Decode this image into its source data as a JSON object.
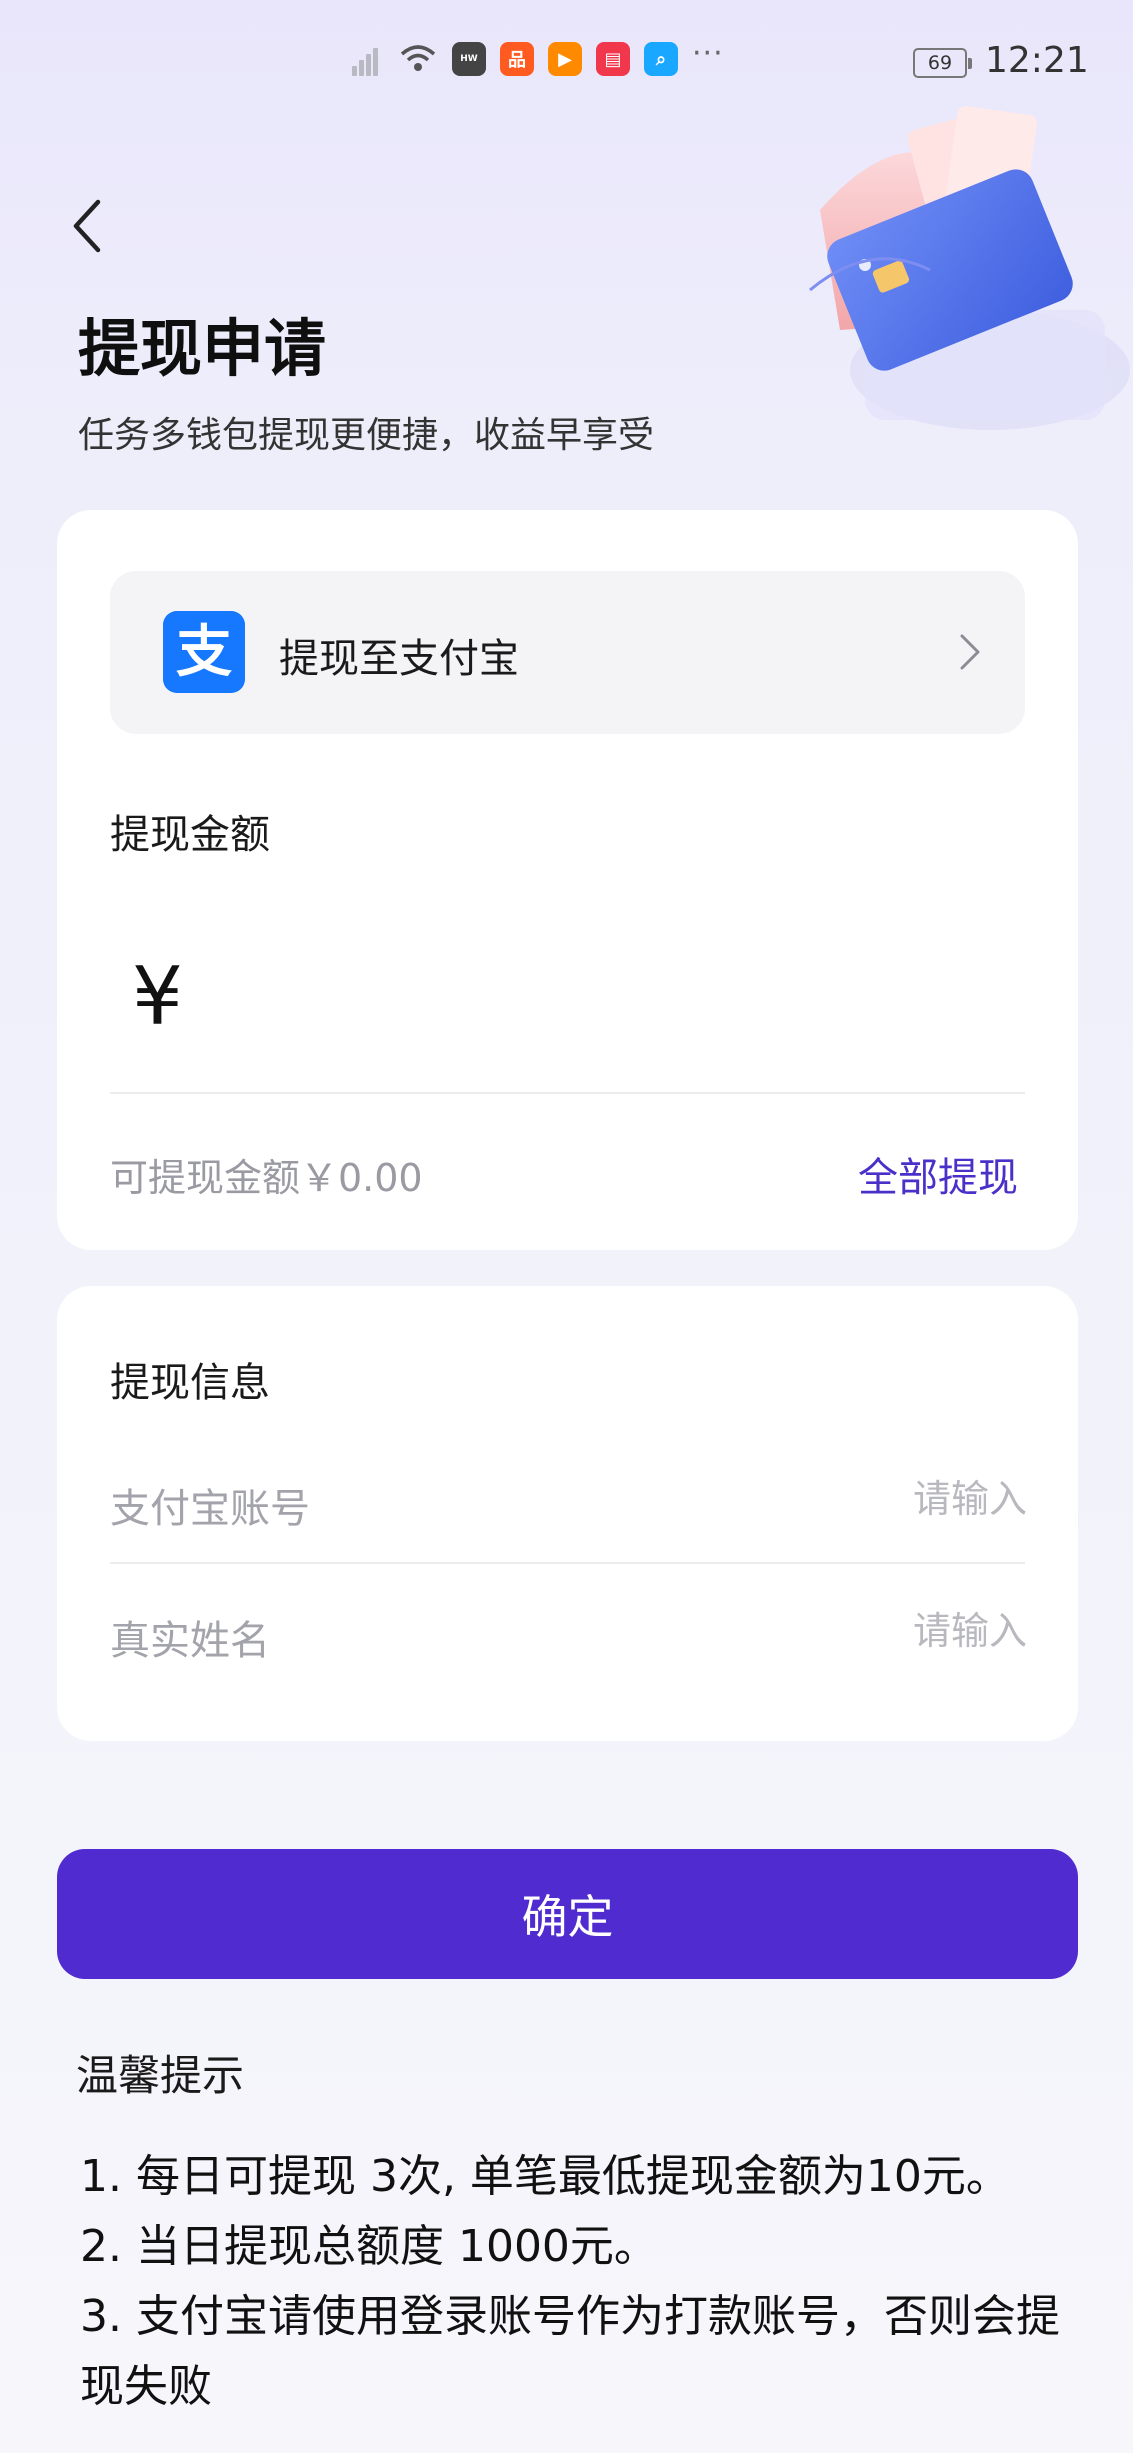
{
  "status_bar": {
    "time": "12:21",
    "battery": "69"
  },
  "header": {
    "title": "提现申请",
    "subtitle": "任务多钱包提现更便捷，收益早享受"
  },
  "withdraw_method": {
    "logo_char": "支",
    "label": "提现至支付宝"
  },
  "amount": {
    "label": "提现金额",
    "currency_symbol": "¥",
    "value": "",
    "available_text": "可提现金额￥0.00",
    "withdraw_all_label": "全部提现"
  },
  "info": {
    "title": "提现信息",
    "fields": [
      {
        "label": "支付宝账号",
        "placeholder": "请输入",
        "value": ""
      },
      {
        "label": "真实姓名",
        "placeholder": "请输入",
        "value": ""
      }
    ]
  },
  "confirm_label": "确定",
  "tips": {
    "title": "温馨提示",
    "items": [
      "1. 每日可提现 3次, 单笔最低提现金额为10元。",
      "2. 当日提现总额度 1000元。",
      "3. 支付宝请使用登录账号作为打款账号，否则会提现失败"
    ]
  },
  "colors": {
    "accent": "#4f2bd0",
    "link": "#4a2fc9",
    "alipay": "#1677ff"
  }
}
